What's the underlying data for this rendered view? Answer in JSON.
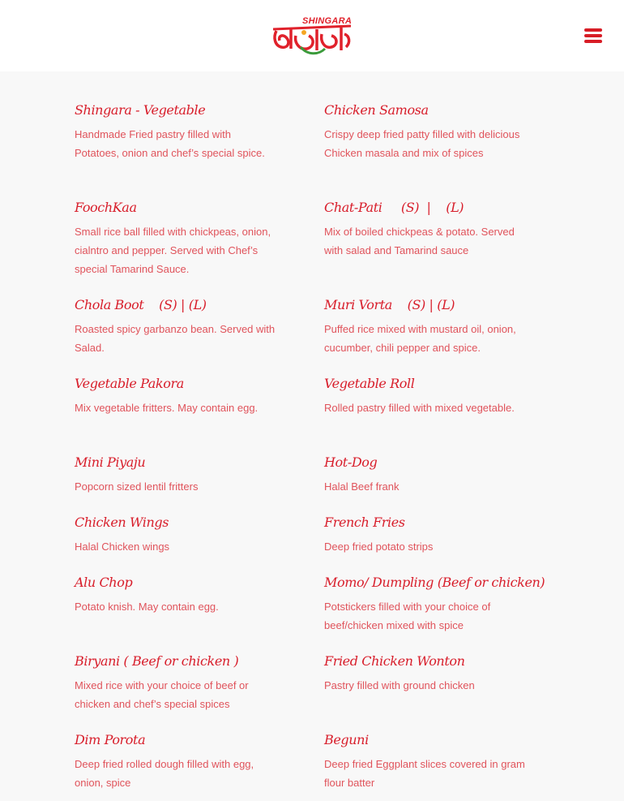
{
  "header": {
    "logo_text": "SHINGARA",
    "logo_bengali": "সিংগারা",
    "menu_icon": "hamburger-menu-icon"
  },
  "colors": {
    "accent": "#d81d2a",
    "description": "#e0535b",
    "background": "#f8f8f8",
    "header_bg": "#ffffff"
  },
  "menu": {
    "items": [
      {
        "title": "Shingara - Vegetable",
        "desc": "Handmade Fried pastry filled with Potatoes, onion and chef’s special spice."
      },
      {
        "title": "Chicken Samosa",
        "desc": "Crispy deep fried patty filled with delicious Chicken masala and mix of spices"
      },
      {
        "title": "FoochKaa",
        "desc": "Small rice ball filled with chickpeas, onion, cialntro and pepper.  Served with Chef’s special Tamarind Sauce."
      },
      {
        "title": "Chat-Pati     (S)  |    (L)",
        "desc": "Mix of boiled chickpeas & potato. Served with salad and Tamarind sauce"
      },
      {
        "title": "Chola Boot    (S) | (L)",
        "desc": "Roasted spicy garbanzo bean. Served with Salad."
      },
      {
        "title": "Muri Vorta    (S) | (L)",
        "desc": "Puffed rice mixed with mustard oil, onion, cucumber, chili pepper  and spice."
      },
      {
        "title": "Vegetable Pakora",
        "desc": "Mix vegetable fritters. May contain egg."
      },
      {
        "title": "Vegetable Roll",
        "desc": "Rolled pastry filled with mixed vegetable."
      },
      {
        "title": "Mini Piyaju",
        "desc": "Popcorn sized lentil fritters"
      },
      {
        "title": "Hot-Dog",
        "desc": "Halal Beef frank"
      },
      {
        "title": "Chicken Wings",
        "desc": "Halal Chicken wings"
      },
      {
        "title": "French Fries",
        "desc": "Deep fried potato strips"
      },
      {
        "title": "Alu Chop",
        "desc": "Potato knish. May contain egg."
      },
      {
        "title": "Momo/ Dumpling (Beef or chicken)",
        "desc": "Potstickers filled with your choice of beef/chicken mixed with spice"
      },
      {
        "title": "Biryani ( Beef or chicken )",
        "desc": "Mixed rice with your choice of beef or chicken and chef’s special spices"
      },
      {
        "title": "Fried Chicken Wonton",
        "desc": "Pastry filled with ground chicken"
      },
      {
        "title": "Dim Porota",
        "desc": "Deep fried rolled dough filled with egg, onion, spice"
      },
      {
        "title": "Beguni",
        "desc": "Deep fried Eggplant slices covered in gram flour batter"
      }
    ]
  }
}
